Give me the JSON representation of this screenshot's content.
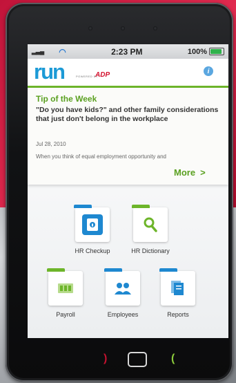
{
  "status_bar": {
    "time": "2:23 PM",
    "battery": "100%",
    "battery_level": 1.0
  },
  "header": {
    "logo": "run",
    "powered_by": "POWERED BY",
    "brand": "ADP"
  },
  "tip": {
    "title": "Tip of the Week",
    "headline": "\"Do you have kids?\" and other family considerations that just don't belong in the workplace",
    "date": "Jul 28, 2010",
    "body": "When you think of equal employment opportunity and",
    "more_label": "More"
  },
  "tiles": [
    {
      "label": "HR Checkup",
      "icon": "checkup-icon",
      "color": "#1e88d0",
      "tab": "#1e88d0"
    },
    {
      "label": "HR Dictionary",
      "icon": "magnifier-icon",
      "color": "#6db52a",
      "tab": "#6db52a"
    },
    {
      "label": "Payroll",
      "icon": "money-icon",
      "color": "#6db52a",
      "tab": "#6db52a"
    },
    {
      "label": "Employees",
      "icon": "people-icon",
      "color": "#1e88d0",
      "tab": "#1e88d0"
    },
    {
      "label": "Reports",
      "icon": "documents-icon",
      "color": "#1e88d0",
      "tab": "#1e88d0"
    }
  ],
  "colors": {
    "accent_green": "#6db52a",
    "accent_blue": "#1c9ad6",
    "brand_red": "#d2102d"
  }
}
